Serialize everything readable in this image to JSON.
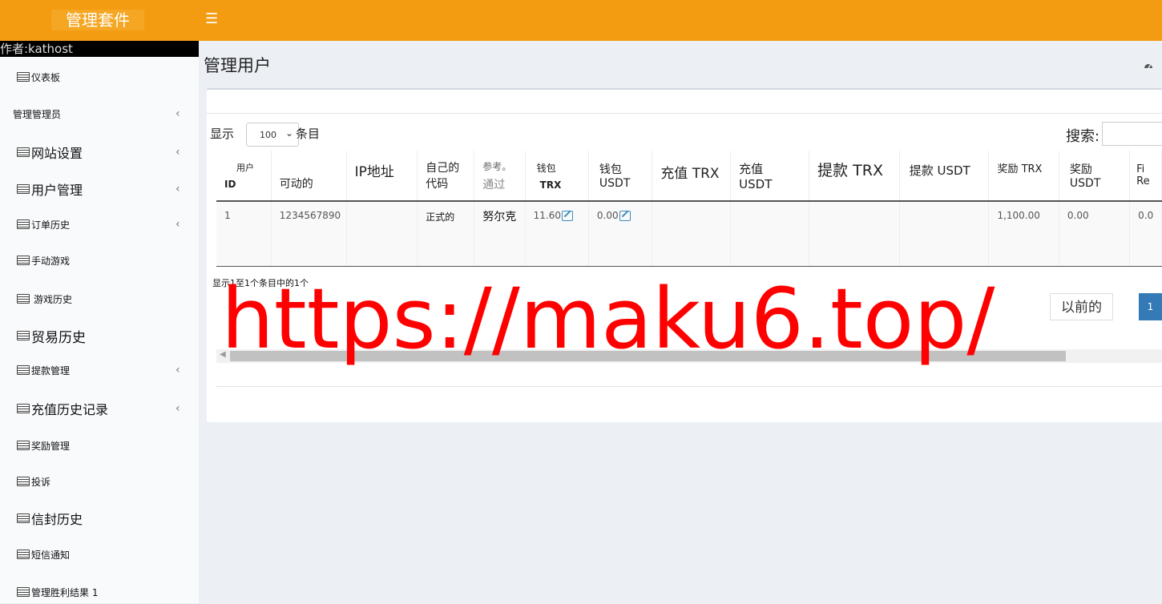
{
  "header": {
    "brand": "管理套件",
    "menu_icon": "☰"
  },
  "sidebar": {
    "author": "作者:kathost",
    "items": [
      {
        "label": "仪表板",
        "icon": "list-icon",
        "has_chevron": false
      },
      {
        "label": "管理管理员",
        "icon": "",
        "has_chevron": true
      },
      {
        "label": "网站设置",
        "icon": "list-icon",
        "has_chevron": true
      },
      {
        "label": "用户管理",
        "icon": "list-icon",
        "has_chevron": true
      },
      {
        "label": "订单历史",
        "icon": "list-icon",
        "has_chevron": true
      },
      {
        "label": "手动游戏",
        "icon": "list-icon",
        "has_chevron": false
      },
      {
        "label": "游戏历史",
        "icon": "list-icon",
        "has_chevron": false
      },
      {
        "label": "贸易历史",
        "icon": "list-icon",
        "has_chevron": false
      },
      {
        "label": "提款管理",
        "icon": "list-icon",
        "has_chevron": true
      },
      {
        "label": "充值历史记录",
        "icon": "list-icon",
        "has_chevron": true
      },
      {
        "label": "奖励管理",
        "icon": "list-icon",
        "has_chevron": false
      },
      {
        "label": "投诉",
        "icon": "list-icon",
        "has_chevron": false
      },
      {
        "label": "信封历史",
        "icon": "list-icon",
        "has_chevron": false
      },
      {
        "label": "短信通知",
        "icon": "list-icon",
        "has_chevron": false
      },
      {
        "label": "管理胜利结果 1",
        "icon": "list-icon",
        "has_chevron": false
      }
    ]
  },
  "page": {
    "title": "管理用户"
  },
  "controls": {
    "show_label": "显示",
    "page_length": "100",
    "entries_label": "条目",
    "search_label": "搜索:"
  },
  "table": {
    "columns": [
      {
        "line1": "用户",
        "line2": "ID"
      },
      {
        "line1": "",
        "line2": "可动的"
      },
      {
        "line1": "IP地址",
        "line2": ""
      },
      {
        "line1": "自己的",
        "line2": "代码"
      },
      {
        "line1": "参考。",
        "line2": "通过"
      },
      {
        "line1": "钱包",
        "line2": "TRX"
      },
      {
        "line1": "钱包",
        "line2": "USDT"
      },
      {
        "line1": "充值 TRX",
        "line2": ""
      },
      {
        "line1": "充值",
        "line2": "USDT"
      },
      {
        "line1": "提款 TRX",
        "line2": ""
      },
      {
        "line1": "提款 USDT",
        "line2": ""
      },
      {
        "line1": "奖励 TRX",
        "line2": ""
      },
      {
        "line1": "奖励",
        "line2": "USDT"
      },
      {
        "line1": "Fi",
        "line2": "Re"
      }
    ],
    "rows": [
      [
        "1",
        "1234567890",
        "",
        "正式的",
        "努尔克",
        "11.60",
        "0.00",
        "",
        "",
        "",
        "",
        "1,100.00",
        "0.00",
        "0.0"
      ]
    ]
  },
  "footer": {
    "info": "显示1至1个条目中的1个",
    "prev_label": "以前的",
    "current_page": "1"
  },
  "watermark": "https://maku6.top/",
  "colors": {
    "topbar": "#f39c12",
    "pagination_active": "#337ab7",
    "watermark": "#ff0000"
  }
}
